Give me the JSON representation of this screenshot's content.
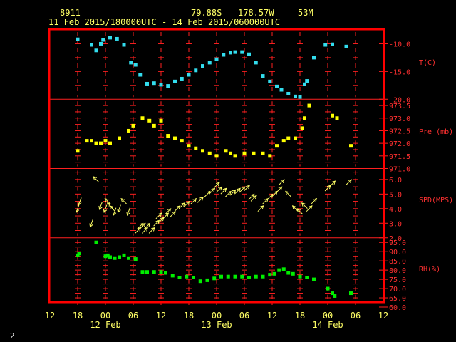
{
  "header": {
    "station_id": "8911",
    "latitude": "79.88S",
    "longitude": "178.57W",
    "elevation": "53M",
    "time_range": "11 Feb 2015/180000UTC - 14 Feb 2015/060000UTC"
  },
  "page_number": "2",
  "colors": {
    "frame": "#ff0000",
    "grid": "#ff2020",
    "text": "#ffff66",
    "temperature": "#33ddee",
    "pressure": "#ffff00",
    "wind": "#ffff66",
    "humidity": "#00ee00"
  },
  "chart_data": {
    "type": "scatter",
    "x_axis": {
      "unit": "hours since 11 Feb 00 UTC",
      "range": [
        12,
        84
      ],
      "tick_labels": [
        "12",
        "18",
        "00",
        "06",
        "12",
        "18",
        "00",
        "06",
        "12",
        "18",
        "00",
        "06",
        "12"
      ],
      "day_labels": [
        {
          "label": "12 Feb",
          "at_hour": 24
        },
        {
          "label": "13 Feb",
          "at_hour": 48
        },
        {
          "label": "14 Feb",
          "at_hour": 72
        }
      ]
    },
    "panels": [
      {
        "name": "temperature",
        "label": "T(C)",
        "ylim": [
          -20,
          -7.5
        ],
        "tick_labels": [
          "-10.0",
          "-15.0",
          "-20.0"
        ],
        "tick_values": [
          -10,
          -15,
          -20
        ],
        "points": [
          [
            18,
            -9.2
          ],
          [
            21,
            -10.2
          ],
          [
            22,
            -11.2
          ],
          [
            23,
            -10.0
          ],
          [
            23.5,
            -9.3
          ],
          [
            25,
            -8.9
          ],
          [
            26.5,
            -9.1
          ],
          [
            28,
            -10.2
          ],
          [
            29.5,
            -13.4
          ],
          [
            30.5,
            -13.8
          ],
          [
            31.5,
            -15.6
          ],
          [
            33,
            -17.2
          ],
          [
            34.5,
            -17.1
          ],
          [
            36,
            -17.4
          ],
          [
            37.5,
            -17.6
          ],
          [
            39,
            -16.8
          ],
          [
            40.5,
            -16.3
          ],
          [
            42,
            -15.6
          ],
          [
            43.5,
            -14.8
          ],
          [
            45,
            -14.0
          ],
          [
            46.5,
            -13.4
          ],
          [
            48,
            -12.8
          ],
          [
            49.5,
            -12.0
          ],
          [
            51,
            -11.6
          ],
          [
            52,
            -11.5
          ],
          [
            53.5,
            -11.5
          ],
          [
            55,
            -11.9
          ],
          [
            56.5,
            -13.4
          ],
          [
            58,
            -15.8
          ],
          [
            59.5,
            -16.8
          ],
          [
            61,
            -17.7
          ],
          [
            62,
            -18.3
          ],
          [
            63.5,
            -19.0
          ],
          [
            65,
            -19.5
          ],
          [
            66,
            -19.6
          ],
          [
            67,
            -17.3
          ],
          [
            67.5,
            -16.7
          ],
          [
            69,
            -12.5
          ],
          [
            71.5,
            -10.2
          ],
          [
            73,
            -10.1
          ],
          [
            76,
            -10.5
          ]
        ]
      },
      {
        "name": "pressure",
        "label": "Pre (mb)",
        "ylim": [
          971,
          973.75
        ],
        "tick_labels": [
          "973.5",
          "973.0",
          "972.5",
          "972.0",
          "971.5",
          "971.0"
        ],
        "tick_values": [
          973.5,
          973.0,
          972.5,
          972.0,
          971.5,
          971.0
        ],
        "points": [
          [
            18,
            971.7
          ],
          [
            20,
            972.1
          ],
          [
            21,
            972.1
          ],
          [
            22,
            972.0
          ],
          [
            23,
            972.0
          ],
          [
            24,
            972.1
          ],
          [
            25,
            972.0
          ],
          [
            27,
            972.2
          ],
          [
            29,
            972.5
          ],
          [
            30,
            972.7
          ],
          [
            32,
            973.0
          ],
          [
            33.5,
            972.9
          ],
          [
            34.5,
            972.7
          ],
          [
            36,
            972.9
          ],
          [
            37.5,
            972.3
          ],
          [
            39,
            972.2
          ],
          [
            40.5,
            972.1
          ],
          [
            42,
            971.9
          ],
          [
            43.5,
            971.8
          ],
          [
            45,
            971.7
          ],
          [
            46.5,
            971.6
          ],
          [
            48,
            971.5
          ],
          [
            50,
            971.7
          ],
          [
            51,
            971.6
          ],
          [
            52,
            971.5
          ],
          [
            54,
            971.6
          ],
          [
            56,
            971.6
          ],
          [
            58,
            971.6
          ],
          [
            59.5,
            971.5
          ],
          [
            61,
            971.9
          ],
          [
            62.5,
            972.1
          ],
          [
            63.5,
            972.2
          ],
          [
            65,
            972.2
          ],
          [
            66.5,
            972.6
          ],
          [
            67,
            973.0
          ],
          [
            68,
            973.5
          ],
          [
            73,
            973.1
          ],
          [
            74,
            973.0
          ],
          [
            77,
            971.9
          ]
        ]
      },
      {
        "name": "wind",
        "label": "SPD(MPS)",
        "ylim": [
          2,
          6.75
        ],
        "tick_labels": [
          "6.0",
          "5.0",
          "4.0",
          "3.0",
          "2.0"
        ],
        "tick_values": [
          6,
          5,
          4,
          3,
          2
        ],
        "note": "wind arrows: position = speed, arrow direction = wind direction",
        "points": [
          [
            18,
            4.0,
            200
          ],
          [
            18.5,
            4.5,
            200
          ],
          [
            21,
            3.0,
            200
          ],
          [
            22,
            6.0,
            315
          ],
          [
            23,
            4.2,
            200
          ],
          [
            24,
            4.0,
            200
          ],
          [
            24.5,
            4.5,
            315
          ],
          [
            25,
            4.2,
            315
          ],
          [
            25.5,
            4.0,
            315
          ],
          [
            26,
            3.8,
            200
          ],
          [
            27,
            4.0,
            200
          ],
          [
            28,
            4.5,
            315
          ],
          [
            29,
            3.8,
            200
          ],
          [
            31,
            2.5,
            45
          ],
          [
            31.5,
            2.8,
            45
          ],
          [
            32,
            2.8,
            45
          ],
          [
            32.5,
            2.5,
            45
          ],
          [
            33,
            2.8,
            45
          ],
          [
            34,
            2.5,
            45
          ],
          [
            35,
            3.0,
            45
          ],
          [
            35.5,
            3.5,
            45
          ],
          [
            36,
            3.2,
            45
          ],
          [
            37,
            3.5,
            45
          ],
          [
            37.5,
            3.8,
            45
          ],
          [
            38.5,
            3.6,
            45
          ],
          [
            39.5,
            4.0,
            45
          ],
          [
            40.5,
            4.2,
            45
          ],
          [
            41.5,
            4.3,
            45
          ],
          [
            43,
            4.5,
            45
          ],
          [
            44.5,
            4.6,
            45
          ],
          [
            46,
            5.0,
            45
          ],
          [
            47,
            5.2,
            45
          ],
          [
            48,
            5.6,
            45
          ],
          [
            48.5,
            5.3,
            45
          ],
          [
            49.5,
            5.2,
            45
          ],
          [
            50.5,
            5.0,
            45
          ],
          [
            51.5,
            5.1,
            45
          ],
          [
            52.5,
            5.2,
            45
          ],
          [
            53.5,
            5.3,
            45
          ],
          [
            54.5,
            5.4,
            45
          ],
          [
            55.5,
            4.8,
            45
          ],
          [
            56,
            4.7,
            45
          ],
          [
            57.5,
            4.0,
            45
          ],
          [
            58.5,
            4.5,
            45
          ],
          [
            59.5,
            4.8,
            45
          ],
          [
            60.5,
            5.0,
            45
          ],
          [
            61.5,
            5.3,
            45
          ],
          [
            62,
            5.8,
            45
          ],
          [
            63.5,
            5.0,
            315
          ],
          [
            65,
            4.0,
            315
          ],
          [
            66,
            3.8,
            315
          ],
          [
            67,
            4.2,
            315
          ],
          [
            68,
            4.0,
            45
          ],
          [
            69,
            4.5,
            45
          ],
          [
            72,
            5.4,
            45
          ],
          [
            73,
            5.7,
            45
          ],
          [
            76.5,
            5.8,
            45
          ]
        ]
      },
      {
        "name": "humidity",
        "label": "RH(%)",
        "ylim": [
          60,
          97.5
        ],
        "tick_labels": [
          "95.0",
          "90.0",
          "85.0",
          "80.0",
          "75.0",
          "70.0",
          "65.0",
          "60.0"
        ],
        "tick_values": [
          95,
          90,
          85,
          80,
          75,
          70,
          65,
          60
        ],
        "points": [
          [
            18,
            88.0
          ],
          [
            18.3,
            89.0
          ],
          [
            22,
            95.0
          ],
          [
            24,
            87.5
          ],
          [
            24.5,
            88.0
          ],
          [
            25,
            87.0
          ],
          [
            26,
            86.5
          ],
          [
            27,
            87.0
          ],
          [
            28,
            88.0
          ],
          [
            29,
            86.5
          ],
          [
            30.5,
            86.0
          ],
          [
            32,
            79.0
          ],
          [
            33,
            79.0
          ],
          [
            34.5,
            79.0
          ],
          [
            36,
            79.0
          ],
          [
            37,
            78.5
          ],
          [
            38.5,
            77.0
          ],
          [
            40,
            76.0
          ],
          [
            41.5,
            76.5
          ],
          [
            43,
            76.0
          ],
          [
            44.5,
            74.0
          ],
          [
            46,
            74.5
          ],
          [
            47.5,
            75.5
          ],
          [
            49,
            76.5
          ],
          [
            50.5,
            76.5
          ],
          [
            52,
            76.5
          ],
          [
            53.5,
            76.5
          ],
          [
            55,
            76.0
          ],
          [
            56.5,
            76.5
          ],
          [
            58,
            76.5
          ],
          [
            59.5,
            77.5
          ],
          [
            60.5,
            78.0
          ],
          [
            61.5,
            80.0
          ],
          [
            62.5,
            80.5
          ],
          [
            63.5,
            78.5
          ],
          [
            64.5,
            78.0
          ],
          [
            66,
            76.5
          ],
          [
            67.5,
            76.0
          ],
          [
            69,
            75.0
          ],
          [
            72,
            70.0
          ],
          [
            73,
            67.5
          ],
          [
            73.5,
            66.0
          ],
          [
            77,
            67.5
          ]
        ]
      }
    ]
  }
}
